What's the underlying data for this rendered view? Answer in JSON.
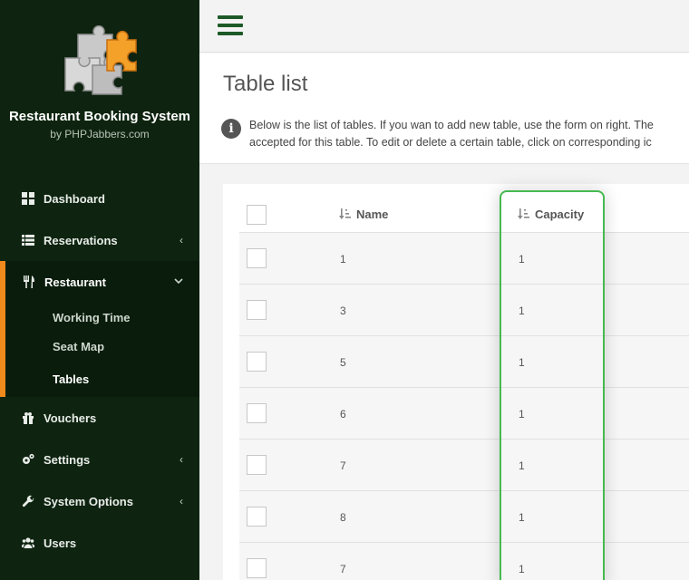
{
  "brand": {
    "title": "Restaurant Booking System",
    "by": "by PHPJabbers.com"
  },
  "sidebar": {
    "items": [
      {
        "label": "Dashboard",
        "icon": "dashboard-icon"
      },
      {
        "label": "Reservations",
        "icon": "list-icon",
        "caret": "‹"
      },
      {
        "label": "Restaurant",
        "icon": "cutlery-icon",
        "caret": "⌄"
      },
      {
        "label": "Vouchers",
        "icon": "gift-icon"
      },
      {
        "label": "Settings",
        "icon": "cogs-icon",
        "caret": "‹"
      },
      {
        "label": "System Options",
        "icon": "wrench-icon",
        "caret": "‹"
      },
      {
        "label": "Users",
        "icon": "users-icon"
      }
    ],
    "restaurant_sub": [
      {
        "label": "Working Time"
      },
      {
        "label": "Seat Map"
      },
      {
        "label": "Tables"
      }
    ],
    "accent": "#f08a1c"
  },
  "page": {
    "title": "Table list",
    "info_line1": "Below is the list of tables. If you wan to add new table, use the form on right. The",
    "info_line2": "accepted for this table. To edit or delete a certain table, click on corresponding ic"
  },
  "table": {
    "headers": {
      "name": "Name",
      "capacity": "Capacity"
    },
    "rows": [
      {
        "name": "1",
        "capacity": "1"
      },
      {
        "name": "3",
        "capacity": "1"
      },
      {
        "name": "5",
        "capacity": "1"
      },
      {
        "name": "6",
        "capacity": "1"
      },
      {
        "name": "7",
        "capacity": "1"
      },
      {
        "name": "8",
        "capacity": "1"
      },
      {
        "name": "7",
        "capacity": "1"
      }
    ]
  },
  "colors": {
    "sidebar_bg": "#0e2410",
    "highlight": "#46b94f",
    "hamburger": "#1d5a27"
  }
}
